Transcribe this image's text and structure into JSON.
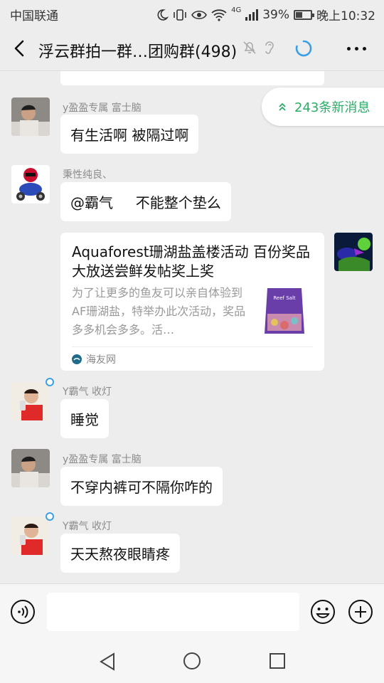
{
  "status_bar": {
    "carrier": "中国联通",
    "network": "4G",
    "battery": "39%",
    "battery_level": 0.39,
    "time": "晚上10:32"
  },
  "header": {
    "title": "浮云群拍一群…团购群(498)",
    "icons": [
      "back-icon",
      "mute-bell-icon",
      "earpiece-icon",
      "refresh-icon",
      "more-icon"
    ]
  },
  "new_messages": {
    "label": "243条新消息",
    "icon": "double-chevron-up-icon",
    "color": "#2aae67"
  },
  "messages": [
    {
      "sender": "y盈盈专属 富士脑",
      "text": "有生活啊 被隔过啊",
      "avatar": "avatar-man-grey"
    },
    {
      "sender": "秉性纯良、",
      "text": "@霸气     不能整个垫么",
      "avatar": "avatar-motorcycle"
    },
    {
      "sender": "Y霸气 收灯",
      "text": "睡觉",
      "avatar": "avatar-red-shirt"
    },
    {
      "sender": "y盈盈专属 富士脑",
      "text": "不穿内裤可不隔你咋的",
      "avatar": "avatar-man-grey"
    },
    {
      "sender": "Y霸气 收灯",
      "text": "天天熬夜眼睛疼",
      "avatar": "avatar-red-shirt"
    }
  ],
  "link_card": {
    "title": "Aquaforest珊湖盐盖楼活动 百份奖品大放送尝鲜发帖奖上奖",
    "description": "为了让更多的鱼友可以亲自体验到AF珊湖盐，特举办此次活动，奖品多多机会多多。活…",
    "source": "海友网",
    "thumb_label": "Reef Salt"
  },
  "input_bar": {
    "placeholder": "",
    "icons": [
      "voice-icon",
      "emoji-icon",
      "plus-icon"
    ]
  },
  "nav_bar": {
    "icons": [
      "nav-back-icon",
      "nav-home-icon",
      "nav-recent-icon"
    ]
  }
}
